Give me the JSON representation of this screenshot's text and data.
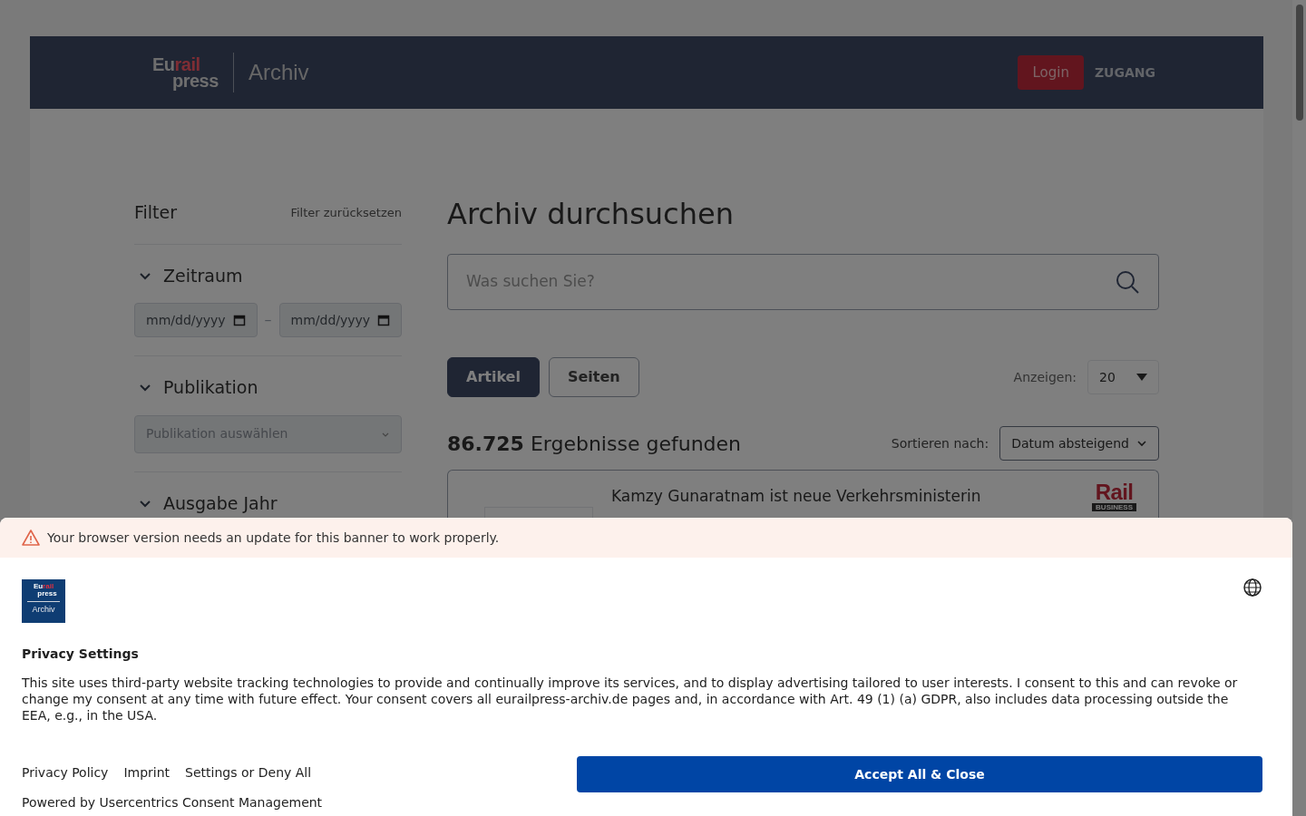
{
  "header": {
    "logo": {
      "part_1": "Eu",
      "part_2": "rail",
      "part_3": "press"
    },
    "section": "Archiv",
    "login": "Login",
    "access": "ZUGANG"
  },
  "filter": {
    "title": "Filter",
    "reset": "Filter zurücksetzen",
    "sections": [
      {
        "kind": "dates",
        "title": "Zeitraum",
        "expanded": true,
        "from_placeholder": "mm/dd/yyyy",
        "separator": "–",
        "to_placeholder": "mm/dd/yyyy"
      },
      {
        "kind": "select",
        "title": "Publikation",
        "expanded": true,
        "placeholder": "Publikation auswählen"
      },
      {
        "kind": "plain",
        "title": "Ausgabe Jahr",
        "expanded": true
      }
    ]
  },
  "main": {
    "title": "Archiv durchsuchen",
    "search": {
      "placeholder": "Was suchen Sie?"
    },
    "tabs": [
      {
        "label": "Artikel",
        "selected": true
      },
      {
        "label": "Seiten",
        "selected": false
      }
    ],
    "show_label": "Anzeigen:",
    "show_value": "20",
    "count": "86.725",
    "count_label": "Ergebnisse gefunden",
    "sort_label": "Sortieren nach:",
    "sort_value": "Datum absteigend",
    "results": [
      {
        "title": "Kamzy Gunaratnam ist neue Verkehrsministerin",
        "publication_logo": "Rail",
        "publication_sub": "BUSINESS"
      }
    ]
  },
  "consent": {
    "warning": "Your browser version needs an update for this banner to work properly.",
    "logo": {
      "part_1": "Eu",
      "part_2": "rail",
      "part_3": "press",
      "part_4": "Archiv"
    },
    "title": "Privacy Settings",
    "text": "This site uses third-party website tracking technologies to provide and continually improve its services, and to display advertising tailored to user interests. I consent to this and can revoke or change my consent at any time with future effect. Your consent covers all eurailpress-archiv.de pages and, in accordance with Art. 49 (1) (a) GDPR, also includes data processing outside the EEA, e.g., in the USA.",
    "links": [
      "Privacy Policy",
      "Imprint",
      "Settings or Deny All"
    ],
    "powered_by": "Powered by Usercentrics Consent Management",
    "accept": "Accept All & Close"
  }
}
